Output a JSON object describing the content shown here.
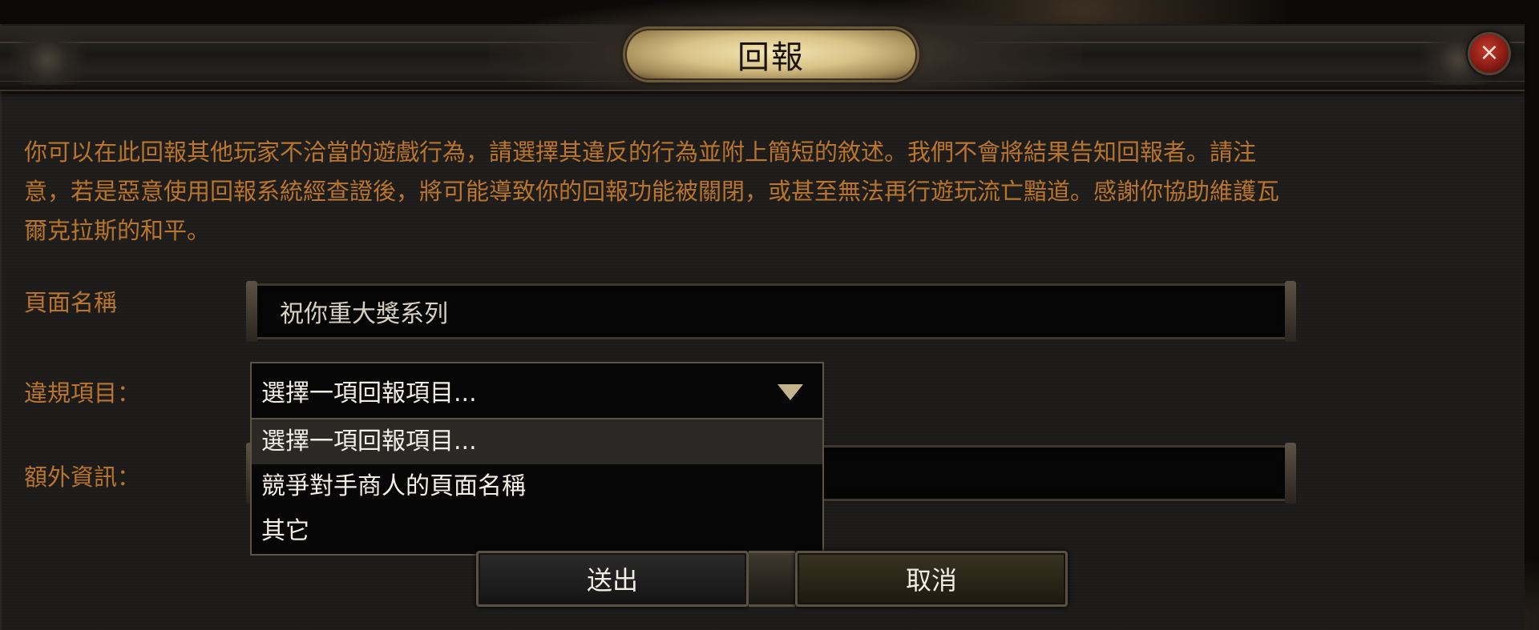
{
  "dialog": {
    "title": "回報",
    "close_label": "×",
    "description_lines": [
      "你可以在此回報其他玩家不洽當的遊戲行為，請選擇其違反的行為並附上簡短的敘述。我們不會將結果告知回報者。請注",
      "意，若是惡意使用回報系統經查證後，將可能導致你的回報功能被關閉，或甚至無法再行遊玩流亡黯道。感謝你協助維護瓦",
      "爾克拉斯的和平。"
    ]
  },
  "form": {
    "page_name_label": "頁面名稱",
    "page_name_value": "祝你重大獎系列",
    "violation_label": "違規項目：",
    "violation_selected": "選擇一項回報項目...",
    "violation_options": [
      "選擇一項回報項目...",
      "競爭對手商人的頁面名稱",
      "其它"
    ],
    "extra_info_label": "額外資訊：",
    "extra_info_value": ""
  },
  "buttons": {
    "submit_label": "送出",
    "cancel_label": "取消"
  }
}
